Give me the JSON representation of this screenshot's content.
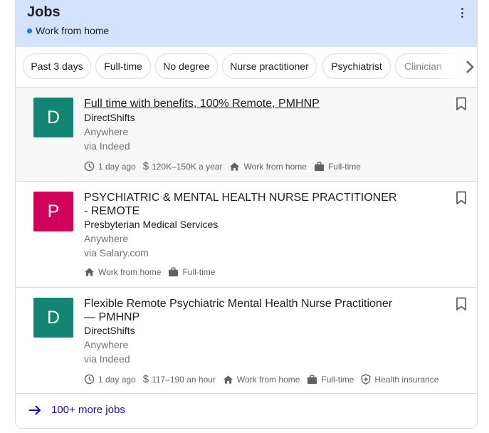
{
  "header": {
    "title": "Jobs",
    "subtitle": "Work from home",
    "accent": "#1a73e8",
    "background": "#d3e3fd"
  },
  "chips": [
    "Past 3 days",
    "Full-time",
    "No degree",
    "Nurse practitioner",
    "Psychiatrist",
    "Clinician"
  ],
  "jobs": [
    {
      "logo_letter": "D",
      "logo_color": "#138575",
      "title": "Full time with benefits, 100% Remote, PMHNP",
      "company": "DirectShifts",
      "location": "Anywhere",
      "via": "via Indeed",
      "posted": "1 day ago",
      "salary": "120K–150K a year",
      "remote": "Work from home",
      "type": "Full-time"
    },
    {
      "logo_letter": "P",
      "logo_color": "#d1005a",
      "title_line1": "PSYCHIATRIC & MENTAL HEALTH NURSE PRACTITIONER",
      "title_line2": "- REMOTE",
      "company": "Presbyterian Medical Services",
      "location": "Anywhere",
      "via": "via Salary.com",
      "remote": "Work from home",
      "type": "Full-time"
    },
    {
      "logo_letter": "D",
      "logo_color": "#138575",
      "title_line1": "Flexible Remote Psychiatric Mental Health Nurse Practitioner",
      "title_line2": "— PMHNP",
      "company": "DirectShifts",
      "location": "Anywhere",
      "via": "via Indeed",
      "posted": "1 day ago",
      "salary": "117–190 an hour",
      "remote": "Work from home",
      "type": "Full-time",
      "benefit": "Health insurance"
    }
  ],
  "more_jobs": "100+ more jobs"
}
